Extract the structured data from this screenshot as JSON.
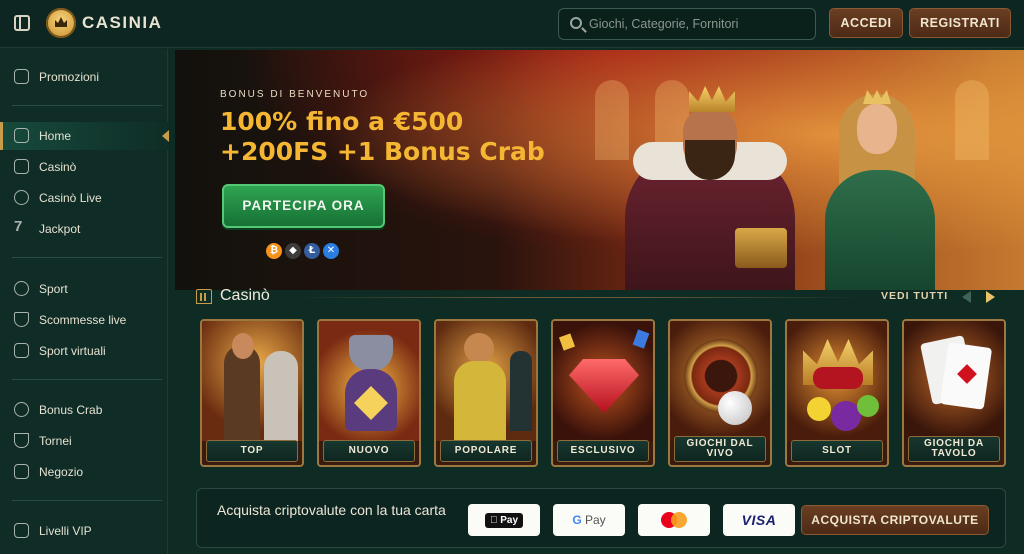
{
  "header": {
    "logo_text": "CASINIA",
    "search_placeholder": "Giochi, Categorie, Fornitori",
    "login_label": "ACCEDI",
    "register_label": "REGISTRATI"
  },
  "sidebar": {
    "items": [
      {
        "label": "Promozioni",
        "icon": "gift-icon"
      },
      {
        "label": "Home",
        "icon": "home-icon",
        "active": true
      },
      {
        "label": "Casinò",
        "icon": "casino-icon"
      },
      {
        "label": "Casinò Live",
        "icon": "chip-icon"
      },
      {
        "label": "Jackpot",
        "icon": "seven-icon"
      },
      {
        "label": "Sport",
        "icon": "football-icon"
      },
      {
        "label": "Scommesse live",
        "icon": "shield-icon"
      },
      {
        "label": "Sport virtuali",
        "icon": "gamepad-icon"
      },
      {
        "label": "Bonus Crab",
        "icon": "crab-icon"
      },
      {
        "label": "Tornei",
        "icon": "trophy-icon"
      },
      {
        "label": "Negozio",
        "icon": "shop-icon"
      },
      {
        "label": "Livelli VIP",
        "icon": "crown-icon"
      }
    ]
  },
  "hero": {
    "eyebrow": "BONUS DI BENVENUTO",
    "title_line1": "100% fino a €500",
    "title_line2": "+200FS +1 Bonus Crab",
    "cta_label": "PARTECIPA ORA",
    "crypto_icons": [
      {
        "name": "bitcoin-icon",
        "glyph": "₿",
        "color": "#f7931a"
      },
      {
        "name": "ethereum-icon",
        "glyph": "◆",
        "color": "#3c3c3d"
      },
      {
        "name": "litecoin-icon",
        "glyph": "Ł",
        "color": "#345d9d"
      },
      {
        "name": "ripple-icon",
        "glyph": "✕",
        "color": "#2a7de1"
      }
    ]
  },
  "casino": {
    "title": "Casinò",
    "see_all": "VEDI TUTTI",
    "tiles": [
      {
        "label": "TOP"
      },
      {
        "label": "NUOVO"
      },
      {
        "label": "POPOLARE"
      },
      {
        "label": "ESCLUSIVO"
      },
      {
        "label": "GIOCHI DAL VIVO"
      },
      {
        "label": "SLOT"
      },
      {
        "label": "GIOCHI DA TAVOLO"
      }
    ]
  },
  "buy_crypto": {
    "text": "Acquista criptovalute con la tua carta",
    "apple_pay": "Pay",
    "google_pay": "Pay",
    "visa": "VISA",
    "button_label": "ACQUISTA CRIPTOVALUTE"
  },
  "colors": {
    "accent_gold": "#c99c4c",
    "cta_green": "#2fa451",
    "background": "#0e2b24"
  }
}
